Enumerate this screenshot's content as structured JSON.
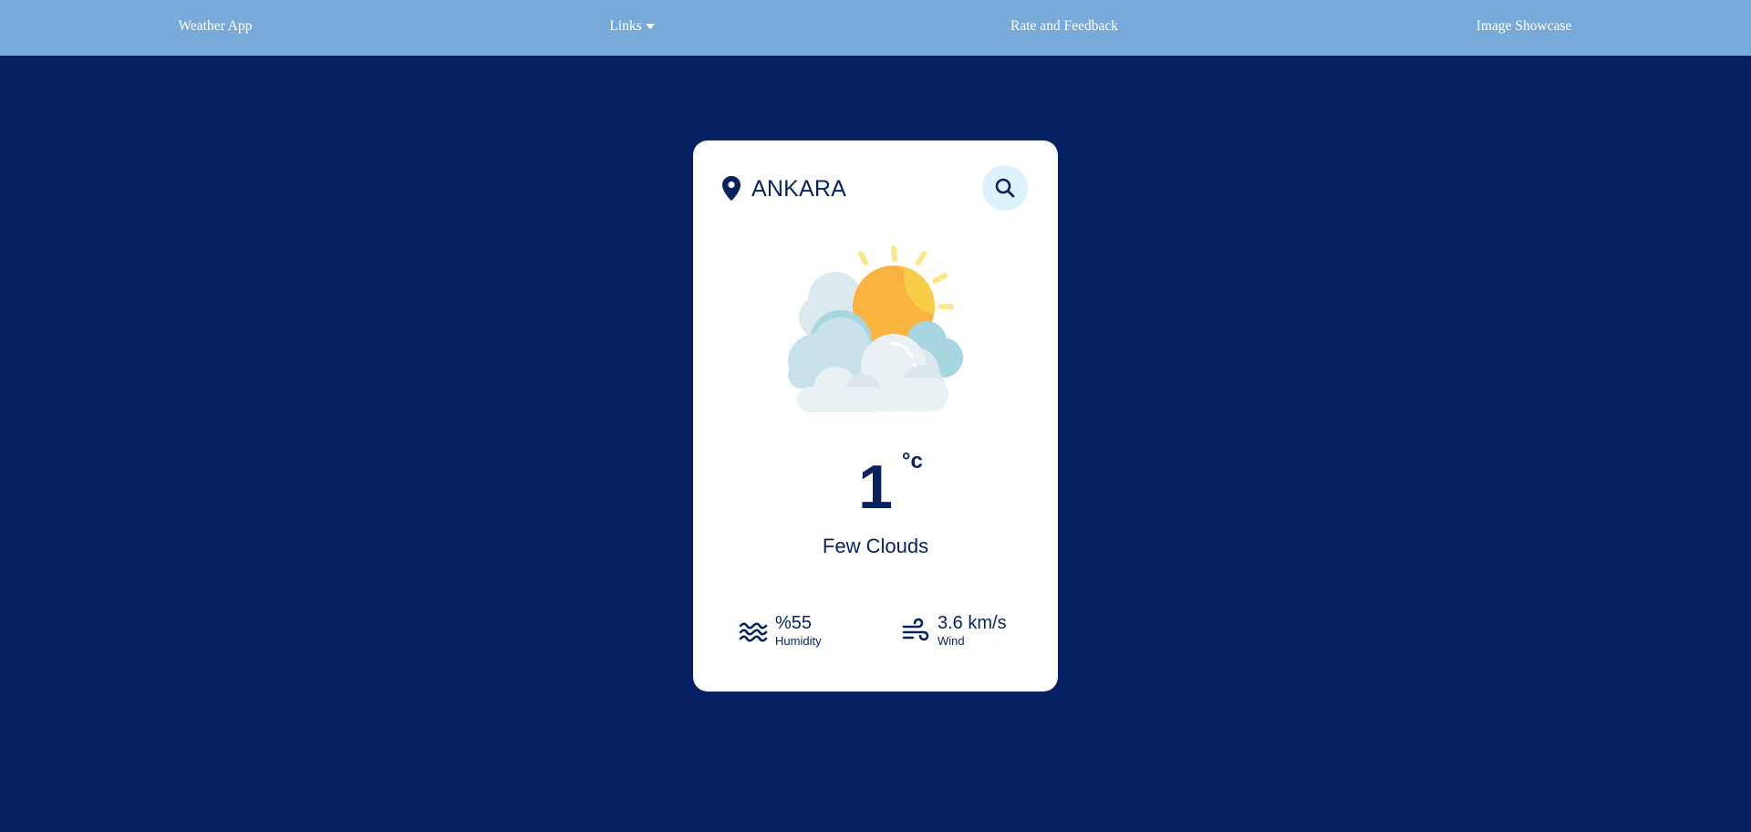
{
  "nav": {
    "items": [
      {
        "label": "Weather App"
      },
      {
        "label": "Links"
      },
      {
        "label": "Rate and Feedback"
      },
      {
        "label": "Image Showcase"
      }
    ]
  },
  "weather": {
    "city": "ANKARA",
    "temperature": "1",
    "unit": "°c",
    "condition": "Few Clouds",
    "humidity": {
      "value": "%55",
      "label": "Humidity"
    },
    "wind": {
      "value": "3.6 km/s",
      "label": "Wind"
    }
  },
  "icons": {
    "location": "map-pin-icon",
    "search": "magnifier-icon",
    "weather": "sun-behind-clouds-icon",
    "humidity": "water-waves-icon",
    "wind": "wind-icon"
  },
  "colors": {
    "background": "#062263",
    "navbar": "#77aad9",
    "card": "#ffffff",
    "accent_text": "#06225f",
    "search_bg": "#dcf3fd"
  }
}
